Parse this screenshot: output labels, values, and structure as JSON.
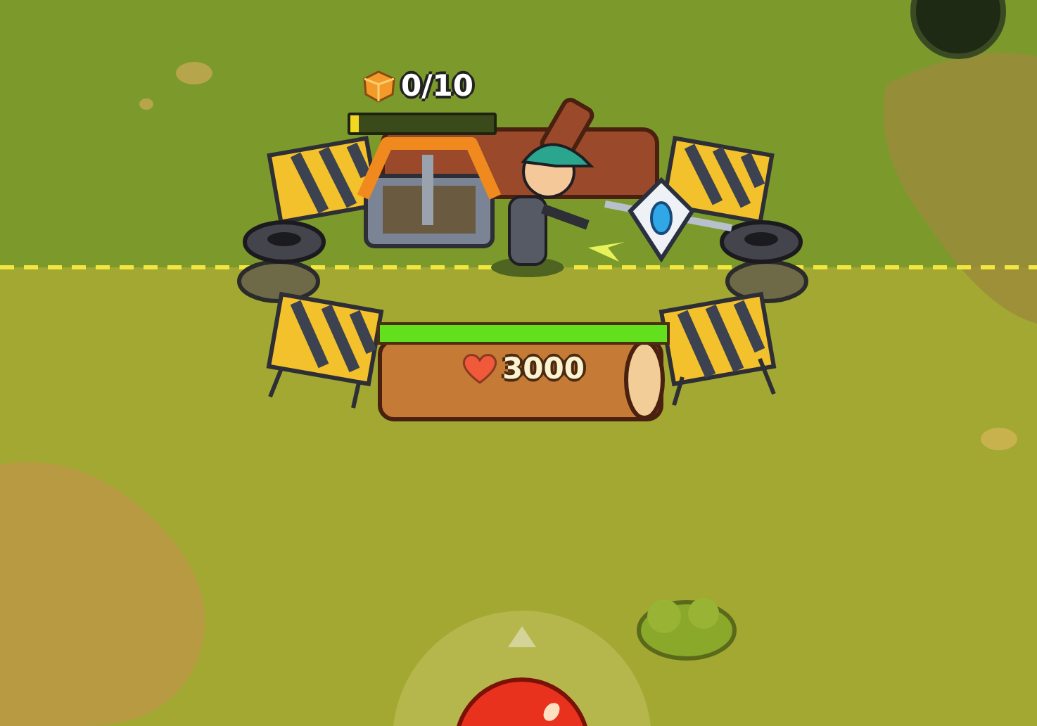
{
  "resource_counter": {
    "value": "0/10"
  },
  "build_progress": {
    "level": 0.06
  },
  "barrier": {
    "health_bar": {
      "level": 1
    },
    "health": "3000"
  }
}
